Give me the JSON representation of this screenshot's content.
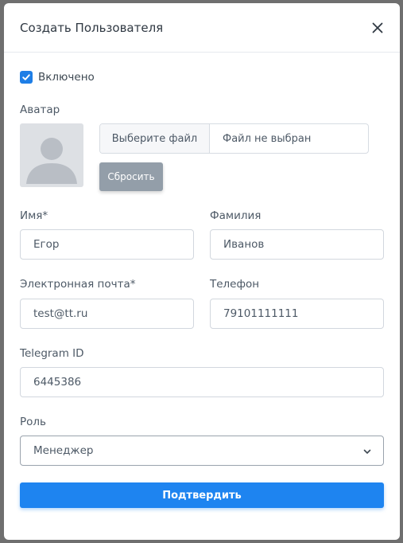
{
  "modal": {
    "title": "Создать Пользователя"
  },
  "enabled": {
    "label": "Включено",
    "checked": true
  },
  "avatar": {
    "label": "Аватар",
    "choose_file": "Выберите файл",
    "no_file": "Файл не выбран",
    "reset": "Сбросить"
  },
  "fields": {
    "first_name": {
      "label": "Имя*",
      "value": "Егор"
    },
    "last_name": {
      "label": "Фамилия",
      "value": "Иванов"
    },
    "email": {
      "label": "Электронная почта*",
      "value": "test@tt.ru"
    },
    "phone": {
      "label": "Телефон",
      "value": "79101111111"
    },
    "telegram": {
      "label": "Telegram ID",
      "value": "6445386"
    },
    "role": {
      "label": "Роль",
      "value": "Менеджер"
    }
  },
  "submit_label": "Подтвердить",
  "colors": {
    "accent": "#1e84f0",
    "reset_button": "#939ea9",
    "overlay": "#6f6f6f"
  }
}
